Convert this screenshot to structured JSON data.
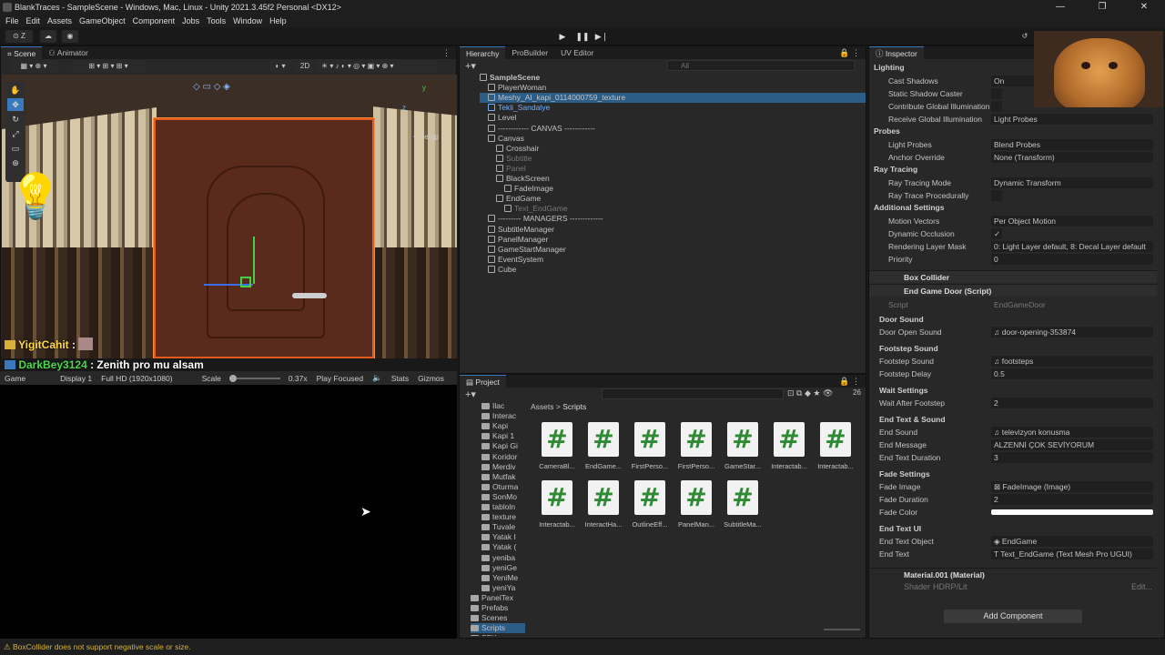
{
  "window": {
    "title": "BlankTraces - SampleScene - Windows, Mac, Linux - Unity 2021.3.45f2 Personal <DX12>",
    "controls": [
      "—",
      "❐",
      "✕"
    ]
  },
  "menu": [
    "File",
    "Edit",
    "Assets",
    "GameObject",
    "Component",
    "Jobs",
    "Tools",
    "Window",
    "Help"
  ],
  "toolbar": {
    "account": "Z"
  },
  "scene": {
    "tabs": [
      "Scene",
      "Animator"
    ],
    "mode_2d": "2D",
    "persp": "< Persp"
  },
  "chat": [
    {
      "user": "YigitCahit",
      "sep": " :",
      "message": "",
      "color": "#ffd84a"
    },
    {
      "user": "DarkBey3124",
      "sep": " :",
      "message": " Zenith pro mu alsam",
      "color": "#4ad84a"
    }
  ],
  "game": {
    "tab": "Game",
    "display": "Display 1",
    "resolution": "Full HD (1920x1080)",
    "scale_label": "Scale",
    "scale_value": "0.37x",
    "play_mode": "Play Focused",
    "stats": "Stats",
    "gizmos": "Gizmos"
  },
  "hierarchy": {
    "tabs": [
      "Hierarchy",
      "ProBuilder",
      "UV Editor"
    ],
    "search_placeholder": "All",
    "items": [
      {
        "label": "SampleScene",
        "indent": 0,
        "style": "bold"
      },
      {
        "label": "PlayerWoman",
        "indent": 1,
        "style": ""
      },
      {
        "label": "Meshy_AI_kapi_0114000759_texture",
        "indent": 1,
        "style": "selected"
      },
      {
        "label": "Tekli_Sandalye",
        "indent": 1,
        "style": "blue"
      },
      {
        "label": "Level",
        "indent": 1,
        "style": ""
      },
      {
        "label": "------------ CANVAS ------------",
        "indent": 1,
        "style": ""
      },
      {
        "label": "Canvas",
        "indent": 1,
        "style": ""
      },
      {
        "label": "Crosshair",
        "indent": 2,
        "style": ""
      },
      {
        "label": "Subtitle",
        "indent": 2,
        "style": "dim"
      },
      {
        "label": "Panel",
        "indent": 2,
        "style": "dim"
      },
      {
        "label": "BlackScreen",
        "indent": 2,
        "style": ""
      },
      {
        "label": "FadeImage",
        "indent": 3,
        "style": ""
      },
      {
        "label": "EndGame",
        "indent": 2,
        "style": ""
      },
      {
        "label": "Text_EndGame",
        "indent": 3,
        "style": "dim"
      },
      {
        "label": "--------- MANAGERS -------------",
        "indent": 1,
        "style": ""
      },
      {
        "label": "SubtitleManager",
        "indent": 1,
        "style": ""
      },
      {
        "label": "PanelManager",
        "indent": 1,
        "style": ""
      },
      {
        "label": "GameStartManager",
        "indent": 1,
        "style": ""
      },
      {
        "label": "EventSystem",
        "indent": 1,
        "style": ""
      },
      {
        "label": "Cube",
        "indent": 1,
        "style": ""
      }
    ]
  },
  "project": {
    "tab": "Project",
    "count": "26",
    "breadcrumb": [
      "Assets",
      ">",
      "Scripts"
    ],
    "folders": [
      "Ilac",
      "Interac",
      "Kapi",
      "Kapi 1",
      "Kapi Gi",
      "Koridor",
      "Merdiv",
      "Mutfak",
      "Oturma",
      "SonMo",
      "tabloln",
      "texture",
      "Tuvale",
      "Yatak I",
      "Yatak (",
      "yeniba",
      "yeniGe",
      "YeniMe",
      "yeniYa",
      "PanelTex",
      "Prefabs",
      "Scenes",
      "Scripts",
      "SFX"
    ],
    "scripts": [
      "CameraBl...",
      "EndGame...",
      "FirstPerso...",
      "FirstPerso...",
      "GameStar...",
      "Interactab...",
      "Interactab...",
      "Interactab...",
      "InteractHa...",
      "OutlineEff...",
      "PanelMan...",
      "SubtitleMa..."
    ]
  },
  "inspector": {
    "tab": "Inspector",
    "lighting": {
      "title": "Lighting",
      "rows": [
        {
          "k": "Cast Shadows",
          "v": "On"
        },
        {
          "k": "Static Shadow Caster",
          "v": ""
        },
        {
          "k": "Contribute Global Illumination",
          "v": ""
        },
        {
          "k": "Receive Global Illumination",
          "v": "Light Probes"
        }
      ]
    },
    "probes": {
      "title": "Probes",
      "rows": [
        {
          "k": "Light Probes",
          "v": "Blend Probes"
        },
        {
          "k": "Anchor Override",
          "v": "None (Transform)"
        }
      ]
    },
    "raytracing": {
      "title": "Ray Tracing",
      "rows": [
        {
          "k": "Ray Tracing Mode",
          "v": "Dynamic Transform"
        },
        {
          "k": "Ray Trace Procedurally",
          "v": ""
        }
      ]
    },
    "additional": {
      "title": "Additional Settings",
      "rows": [
        {
          "k": "Motion Vectors",
          "v": "Per Object Motion"
        },
        {
          "k": "Dynamic Occlusion",
          "v": "✓"
        },
        {
          "k": "Rendering Layer Mask",
          "v": "0: Light Layer default, 8: Decal Layer default"
        },
        {
          "k": "Priority",
          "v": "0"
        }
      ]
    },
    "box_collider": "Box Collider",
    "end_game_door": "End Game Door (Script)",
    "script_label": "Script",
    "script_value": "EndGameDoor",
    "sections": [
      {
        "title": "Door Sound",
        "rows": [
          {
            "k": "Door Open Sound",
            "v": "♫ door-opening-353874"
          }
        ]
      },
      {
        "title": "Footstep Sound",
        "rows": [
          {
            "k": "Footstep Sound",
            "v": "♫ footsteps"
          },
          {
            "k": "Footstep Delay",
            "v": "0.5"
          }
        ]
      },
      {
        "title": "Wait Settings",
        "rows": [
          {
            "k": "Wait After Footstep",
            "v": "2"
          }
        ]
      },
      {
        "title": "End Text & Sound",
        "rows": [
          {
            "k": "End Sound",
            "v": "♫ televizyon konusma"
          },
          {
            "k": "End Message",
            "v": "ALZENNİ ÇOK SEVİYORUM"
          },
          {
            "k": "End Text Duration",
            "v": "3"
          }
        ]
      },
      {
        "title": "Fade Settings",
        "rows": [
          {
            "k": "Fade Image",
            "v": "⊠ FadeImage (Image)"
          },
          {
            "k": "Fade Duration",
            "v": "2"
          },
          {
            "k": "Fade Color",
            "v": ""
          }
        ]
      },
      {
        "title": "End Text UI",
        "rows": [
          {
            "k": "End Text Object",
            "v": "◈ EndGame"
          },
          {
            "k": "End Text",
            "v": "T Text_EndGame (Text Mesh Pro UGUI)"
          }
        ]
      }
    ],
    "material": "Material.001 (Material)",
    "shader_label": "Shader",
    "shader_value": "HDRP/Lit",
    "edit": "Edit...",
    "add_component": "Add Component"
  },
  "status": "⚠ BoxCollider does not support negative scale or size.",
  "colors": {
    "accent": "#3a79bb",
    "door_outline": "#e35b1b",
    "script_green": "#2e8a34"
  }
}
